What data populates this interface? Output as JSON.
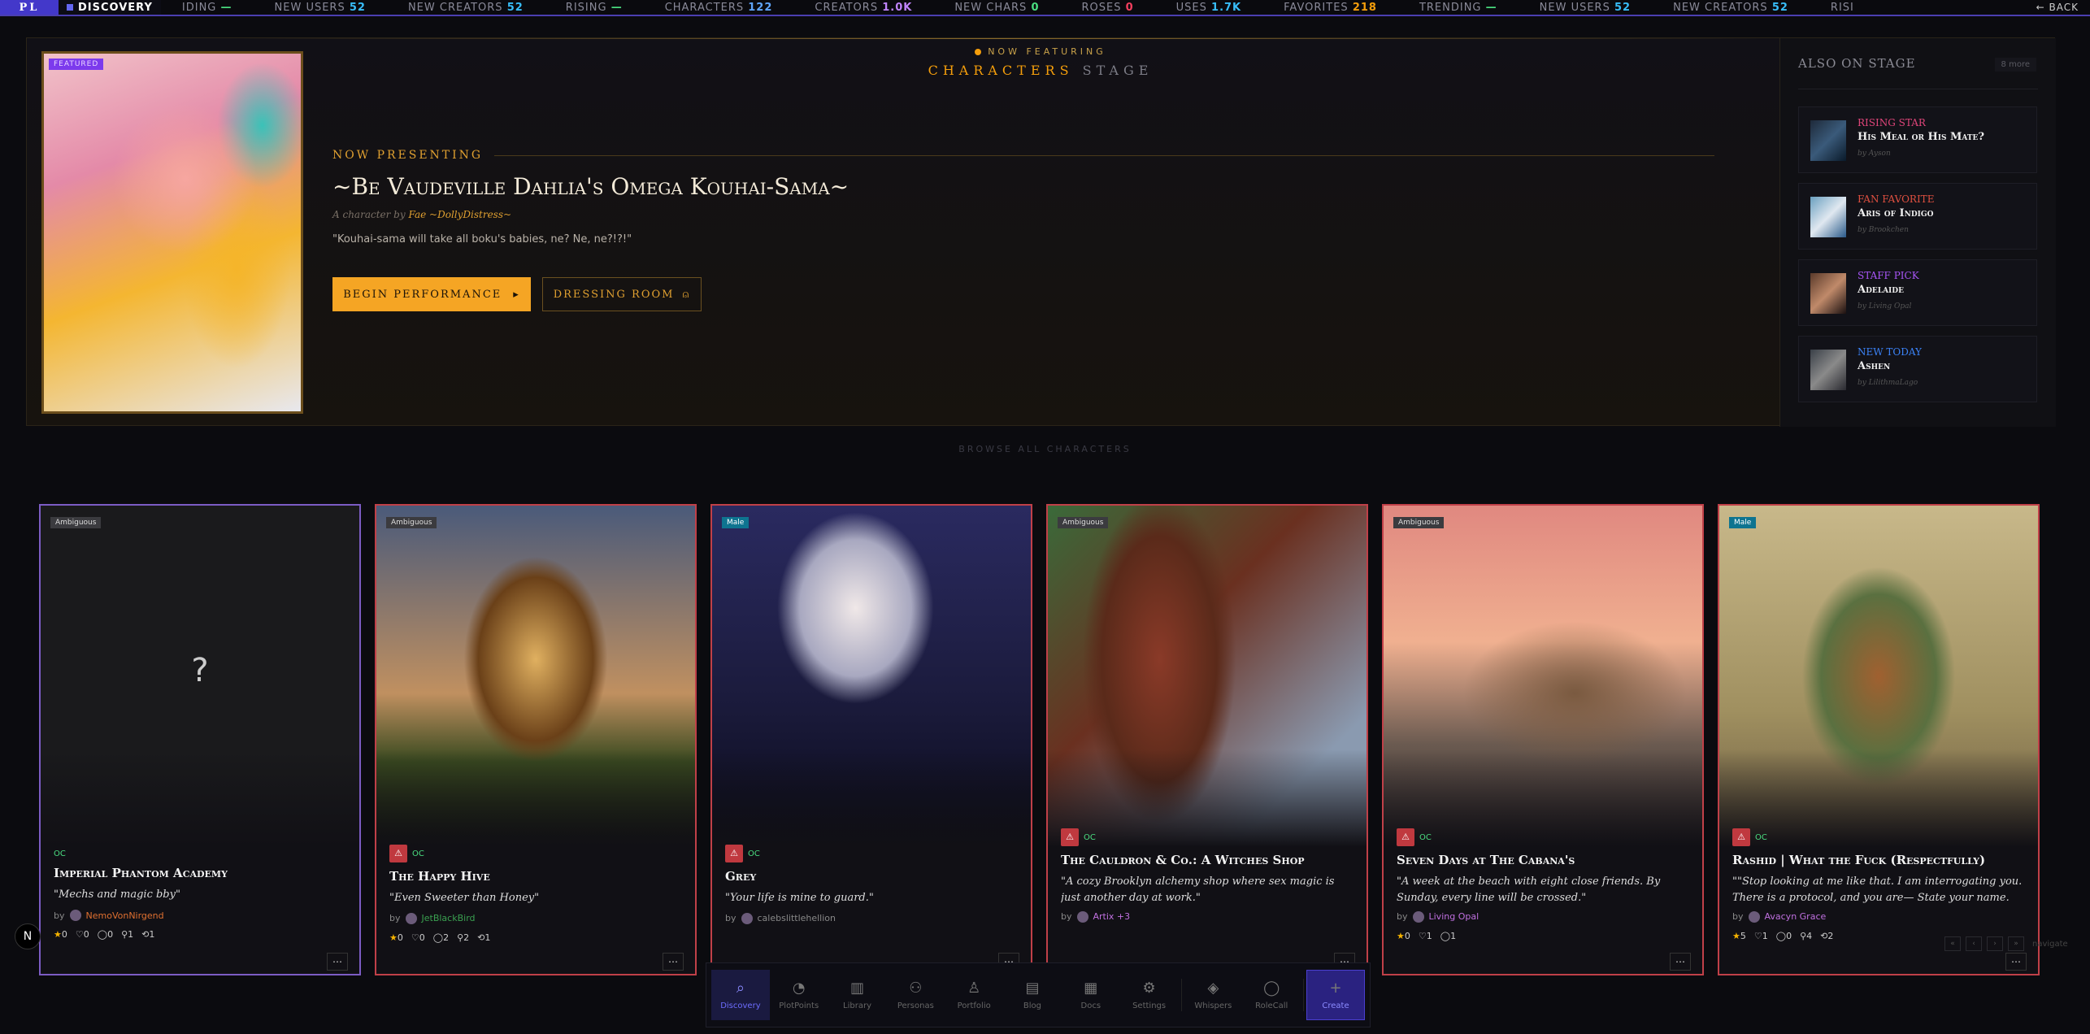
{
  "ticker": {
    "logo": "PL",
    "discovery": "DISCOVERY",
    "items": [
      {
        "label": "IDING",
        "value": "—",
        "color": "#4ade80"
      },
      {
        "label": "NEW USERS",
        "value": "52",
        "color": "#38bdf8"
      },
      {
        "label": "NEW CREATORS",
        "value": "52",
        "color": "#38bdf8"
      },
      {
        "label": "RISING",
        "value": "—",
        "color": "#4ade80"
      },
      {
        "label": "CHARACTERS",
        "value": "122",
        "color": "#60a5fa"
      },
      {
        "label": "CREATORS",
        "value": "1.0K",
        "color": "#c084fc"
      },
      {
        "label": "NEW CHARS",
        "value": "0",
        "color": "#4ade80"
      },
      {
        "label": "ROSES",
        "value": "0",
        "color": "#f43f5e"
      },
      {
        "label": "USES",
        "value": "1.7K",
        "color": "#38bdf8"
      },
      {
        "label": "FAVORITES",
        "value": "218",
        "color": "#f59e0b"
      },
      {
        "label": "TRENDING",
        "value": "—",
        "color": "#4ade80"
      },
      {
        "label": "NEW USERS",
        "value": "52",
        "color": "#38bdf8"
      },
      {
        "label": "NEW CREATORS",
        "value": "52",
        "color": "#38bdf8"
      },
      {
        "label": "RISI",
        "value": "",
        "color": "#4ade80"
      }
    ],
    "back": "← BACK"
  },
  "hero": {
    "featured_badge": "FEATURED",
    "now_featuring": "NOW FEATURING",
    "stage_a": "CHARACTERS",
    "stage_b": "STAGE",
    "now_presenting": "NOW PRESENTING",
    "title": "~Be Vaudeville Dahlia's Omega Kouhai-Sama~",
    "by_prefix": "A character by",
    "author": "Fae ~DollyDistress~",
    "quote": "\"Kouhai-sama will take all boku's babies, ne? Ne, ne?!?!\"",
    "begin_label": "BEGIN PERFORMANCE",
    "dressing_label": "DRESSING ROOM"
  },
  "side": {
    "heading": "ALSO ON STAGE",
    "more": "8 more",
    "picks": [
      {
        "tag": "RISING STAR",
        "tag_color": "#e0457a",
        "name": "His Meal or His Mate?",
        "by": "by Ayson"
      },
      {
        "tag": "FAN FAVORITE",
        "tag_color": "#e05040",
        "name": "Aris of Indigo",
        "by": "by Brookchen"
      },
      {
        "tag": "STAFF PICK",
        "tag_color": "#a855f7",
        "name": "Adelaide",
        "by": "by Living Opal"
      },
      {
        "tag": "NEW TODAY",
        "tag_color": "#3b82f6",
        "name": "Ashen",
        "by": "by LilithmaLago"
      }
    ]
  },
  "browse": "BROWSE ALL CHARACTERS",
  "cards": [
    {
      "tag": "Ambiguous",
      "oc": "OC",
      "title": "Imperial Phantom Academy",
      "quote": "\"Mechs and magic bby\"",
      "by": "by",
      "author": "NemoVonNirgend",
      "author_color": "#e07030",
      "stats": [
        "0",
        "0",
        "0",
        "1",
        "1"
      ],
      "placeholder": "?"
    },
    {
      "tag": "Ambiguous",
      "oc": "OC",
      "title": "The Happy Hive",
      "quote": "\"Even Sweeter than Honey\"",
      "by": "by",
      "author": "JetBlackBird",
      "author_color": "#3aa050",
      "stats": [
        "0",
        "0",
        "2",
        "2",
        "1"
      ]
    },
    {
      "tag": "Male",
      "oc": "OC",
      "title": "Grey",
      "quote": "\"Your life is mine to guard.\"",
      "by": "by",
      "author": "calebslittlehellion",
      "author_color": "#888",
      "stats": []
    },
    {
      "tag": "Ambiguous",
      "oc": "OC",
      "title": "The Cauldron & Co.: A Witches Shop",
      "quote": "\"A cozy Brooklyn alchemy shop where sex magic is just another day at work.\"",
      "by": "by",
      "author": "Artix +3",
      "author_color": "#c070e0",
      "stats": []
    },
    {
      "tag": "Ambiguous",
      "oc": "OC",
      "title": "Seven Days at The Cabana's",
      "quote": "\"A week at the beach with eight close friends. By Sunday, every line will be crossed.\"",
      "by": "by",
      "author": "Living Opal",
      "author_color": "#c070e0",
      "stats": [
        "0",
        "1",
        "1"
      ]
    },
    {
      "tag": "Male",
      "oc": "OC",
      "title": "Rashid | What the Fuck (Respectfully)",
      "quote": "\"\"Stop looking at me like that. I am interrogating you. There is a protocol, and you are— State your name. Your...",
      "by": "by",
      "author": "Avacyn Grace",
      "author_color": "#c070e0",
      "stats": [
        "5",
        "1",
        "0",
        "4",
        "2"
      ]
    }
  ],
  "nav": [
    {
      "label": "Discovery",
      "icon": "search-icon"
    },
    {
      "label": "PlotPoints",
      "icon": "gauge-icon"
    },
    {
      "label": "Library",
      "icon": "library-icon"
    },
    {
      "label": "Personas",
      "icon": "users-icon"
    },
    {
      "label": "Portfolio",
      "icon": "user-icon"
    },
    {
      "label": "Blog",
      "icon": "blog-icon"
    },
    {
      "label": "Docs",
      "icon": "docs-icon"
    },
    {
      "label": "Settings",
      "icon": "gear-icon"
    },
    {
      "label": "Whispers",
      "icon": "tag-icon"
    },
    {
      "label": "RoleCall",
      "icon": "chat-icon"
    },
    {
      "label": "Create",
      "icon": "plus-icon"
    }
  ],
  "avatar": "N",
  "pager_text": "navigate"
}
